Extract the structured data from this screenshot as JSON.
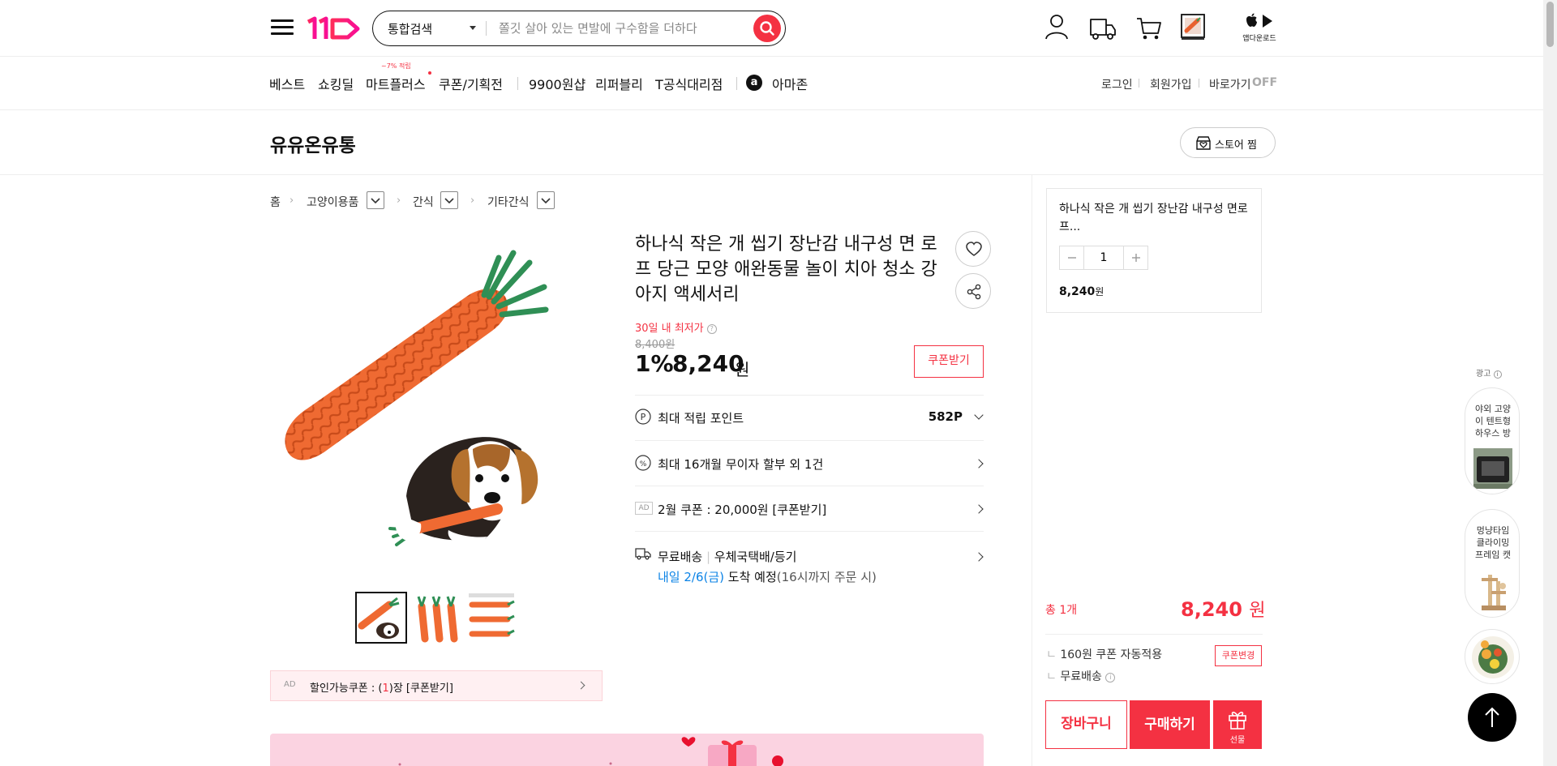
{
  "header": {
    "search": {
      "category": "통합검색",
      "placeholder": "쫄깃 살아 있는 면발에 구수함을 더하다"
    },
    "icons": [
      "user-icon",
      "truck-icon",
      "cart-icon",
      "recent-product-icon"
    ],
    "app_download": "앱다운로드"
  },
  "nav": {
    "items": [
      "베스트",
      "쇼킹딜",
      "마트플러스",
      "쿠폰/기획전",
      "9900원샵",
      "리퍼블리",
      "T공식대리점",
      "아마존"
    ],
    "mart_badge": "~7% 적립",
    "top_links": [
      "로그인",
      "회원가입",
      "바로가기"
    ],
    "shortcut_state": "OFF"
  },
  "store": {
    "name": "유유온유통",
    "fav_label": "스토어 찜"
  },
  "breadcrumb": {
    "home": "홈",
    "levels": [
      "고양이용품",
      "간식",
      "기타간식"
    ]
  },
  "product": {
    "title": "하나식 작은 개 씹기 장난감 내구성 면 로프 당근 모양 애완동물 놀이 치아 청소 강아지 액세서리",
    "lowest_label": "30일 내 최저가",
    "original_price": "8,400원",
    "discount_rate": "1%",
    "sale_price": "8,240",
    "won": "원",
    "coupon_button": "쿠폰받기",
    "points_label": "최대 적립 포인트",
    "points_value": "582P",
    "installment": "최대 16개월 무이자 할부 외 1건",
    "ad_chip": "AD",
    "feb_coupon": "2월 쿠폰 : 20,000원 [쿠폰받기]",
    "shipping_free": "무료배송",
    "shipping_method": "우체국택배/등기",
    "arrival_date": "내일 2/6(금)",
    "arrival_text": "도착 예정",
    "arrival_note": "(16시까지 주문 시)",
    "ad_coupon": {
      "prefix": "할인가능쿠폰 : (",
      "count": "1",
      "suffix": ")장 [쿠폰받기]"
    },
    "thumbnails": 3
  },
  "right_panel": {
    "product_title": "하나식 작은 개 씹기 장난감 내구성 면로프...",
    "quantity": "1",
    "price": "8,240",
    "price_won": "원",
    "total_label": "총 1개",
    "total_price": "8,240",
    "coupon_applied": "160원 쿠폰 자동적용",
    "free_shipping": "무료배송",
    "coupon_change": "쿠폰변경",
    "cart": "장바구니",
    "buy": "구매하기",
    "gift": "선물"
  },
  "ad_rail": {
    "label": "광고",
    "cards": [
      {
        "text": "야외 고양이 텐트형 하우스 방"
      },
      {
        "text": "멍냥타임 클라이밍 프레임 캣"
      }
    ]
  },
  "colors": {
    "accent": "#f43142",
    "brand_gradient_start": "#ff2c5b",
    "brand_gradient_end": "#f80e96",
    "link_blue": "#0b83e6"
  }
}
